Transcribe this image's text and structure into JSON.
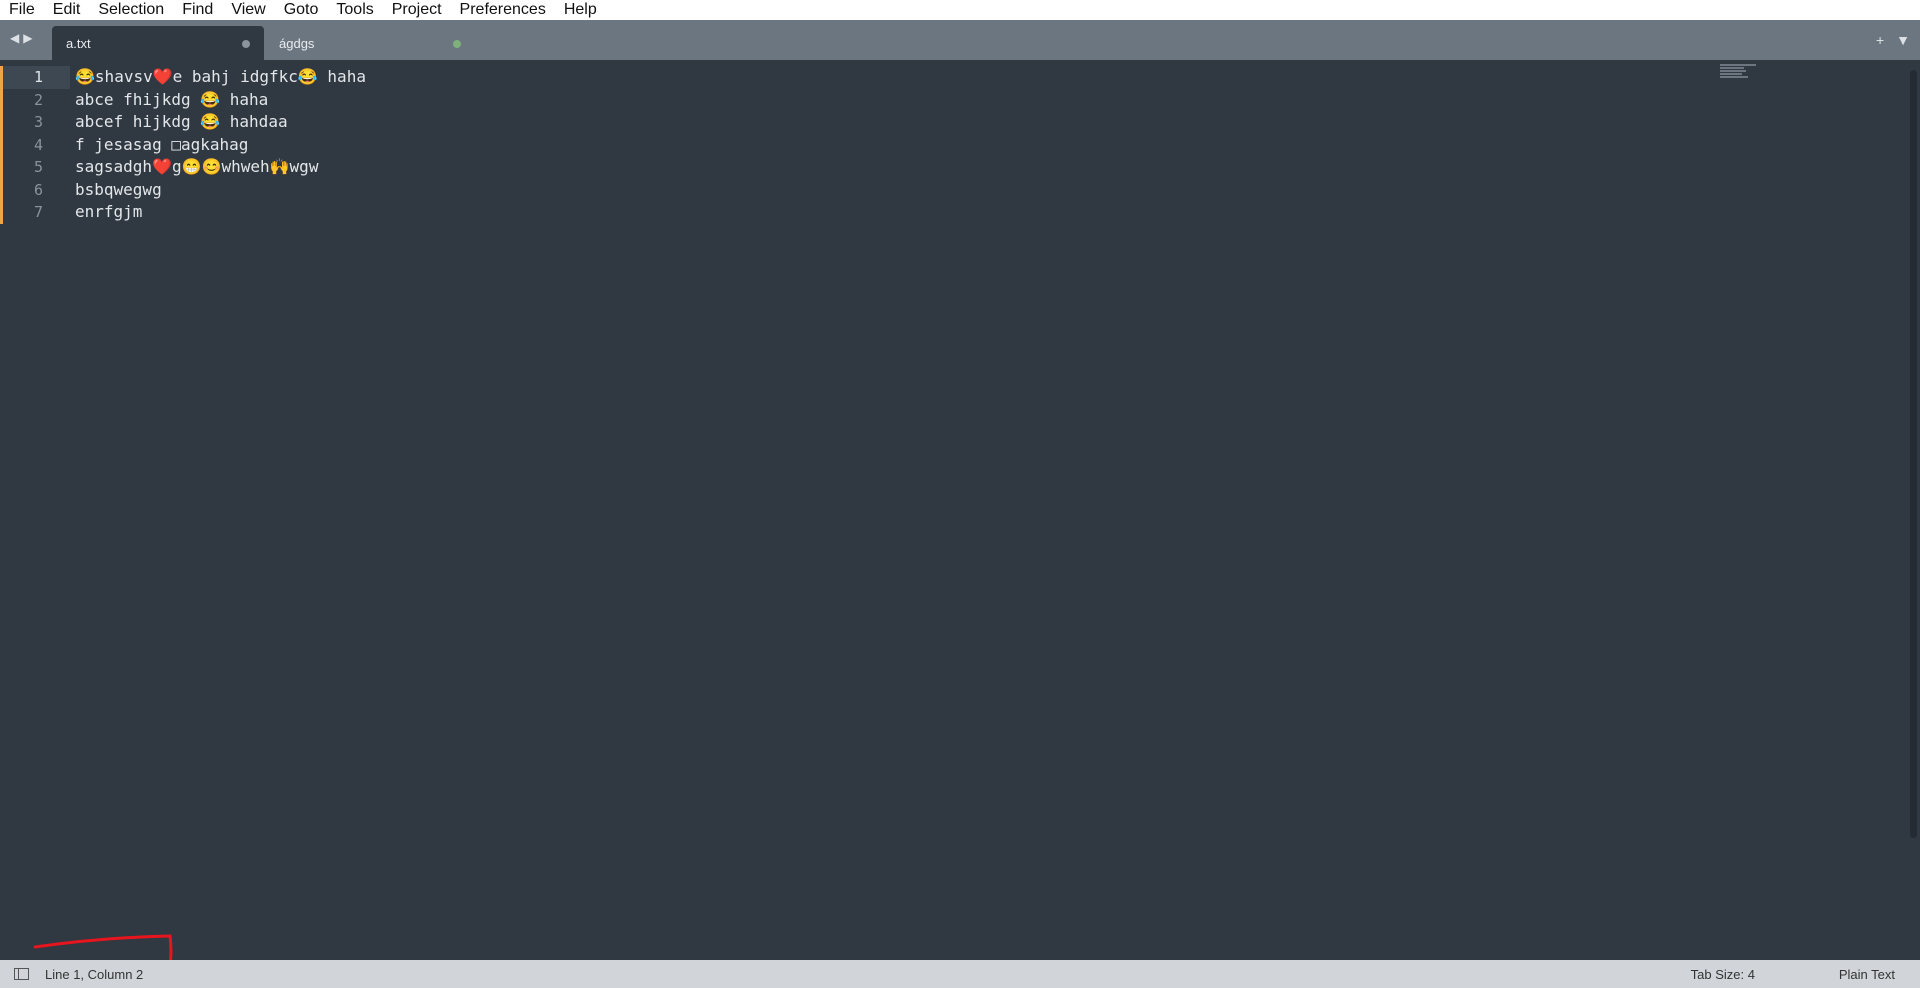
{
  "menu": [
    "File",
    "Edit",
    "Selection",
    "Find",
    "View",
    "Goto",
    "Tools",
    "Project",
    "Preferences",
    "Help"
  ],
  "tabs": [
    {
      "label": "a.txt",
      "active": true
    },
    {
      "label": "ágdgs",
      "active": false
    }
  ],
  "editor": {
    "line_numbers": [
      "1",
      "2",
      "3",
      "4",
      "5",
      "6",
      "7"
    ],
    "lines": [
      "😂shavsv❤️e bahj idgfkc😂 haha",
      "abce fhijkdg 😂 haha",
      "abcef hijkdg 😂 hahdaa",
      "f jesasag □agkahag",
      "sagsadgh❤️g😁😊whweh🙌wgw",
      "bsbqwegwg",
      "enrfgjm"
    ]
  },
  "status": {
    "position": "Line 1, Column 2",
    "tab_size": "Tab Size: 4",
    "syntax": "Plain Text"
  },
  "colors": {
    "editor_bg": "#303841",
    "tabbar_bg": "#6c7680",
    "modified_marker": "#f0a545",
    "annotation": "#e8141e"
  }
}
